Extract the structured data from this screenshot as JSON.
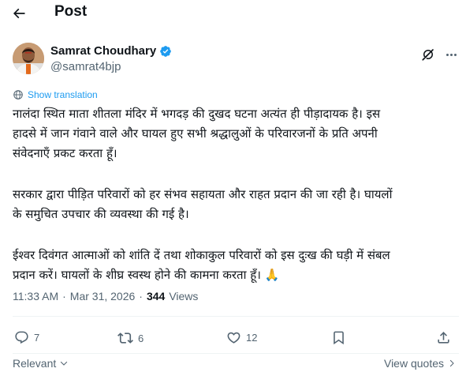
{
  "header": {
    "title": "Post"
  },
  "author": {
    "name": "Samrat Choudhary",
    "handle": "@samrat4bjp"
  },
  "translate": {
    "label": "Show translation"
  },
  "tweet": {
    "paragraphs": [
      [
        "नालंदा स्थित माता शीतला मंदिर में भगदड़ की दुखद घटना अत्यंत ही पीड़ादायक है। इस",
        "हादसे में जान गंवाने वाले और घायल हुए सभी श्रद्धालुओं के परिवारजनों के प्रति अपनी",
        "संवेदनाएँ प्रकट करता हूँ।"
      ],
      [
        "सरकार द्वारा पीड़ित परिवारों को हर संभव सहायता और राहत प्रदान की जा रही है। घायलों",
        "के समुचित उपचार की व्यवस्था की गई है।"
      ],
      [
        "ईश्वर दिवंगत आत्माओं को शांति दें तथा शोकाकुल परिवारों को इस दुःख की घड़ी में संबल",
        "प्रदान करें। घायलों के शीघ्र स्वस्थ होने की कामना करता हूँ। 🙏"
      ]
    ]
  },
  "meta": {
    "time": "11:33 AM",
    "separator_1": "·",
    "date": "Mar 31, 2026",
    "separator_2": "·",
    "views_count": "344",
    "views_label": "Views"
  },
  "actions": {
    "replies": "7",
    "reposts": "6",
    "likes": "12"
  },
  "footer": {
    "sort_label": "Relevant",
    "quotes_label": "View quotes"
  },
  "colors": {
    "accent": "#1d9bf0",
    "muted": "#536471",
    "text": "#0f1419"
  }
}
